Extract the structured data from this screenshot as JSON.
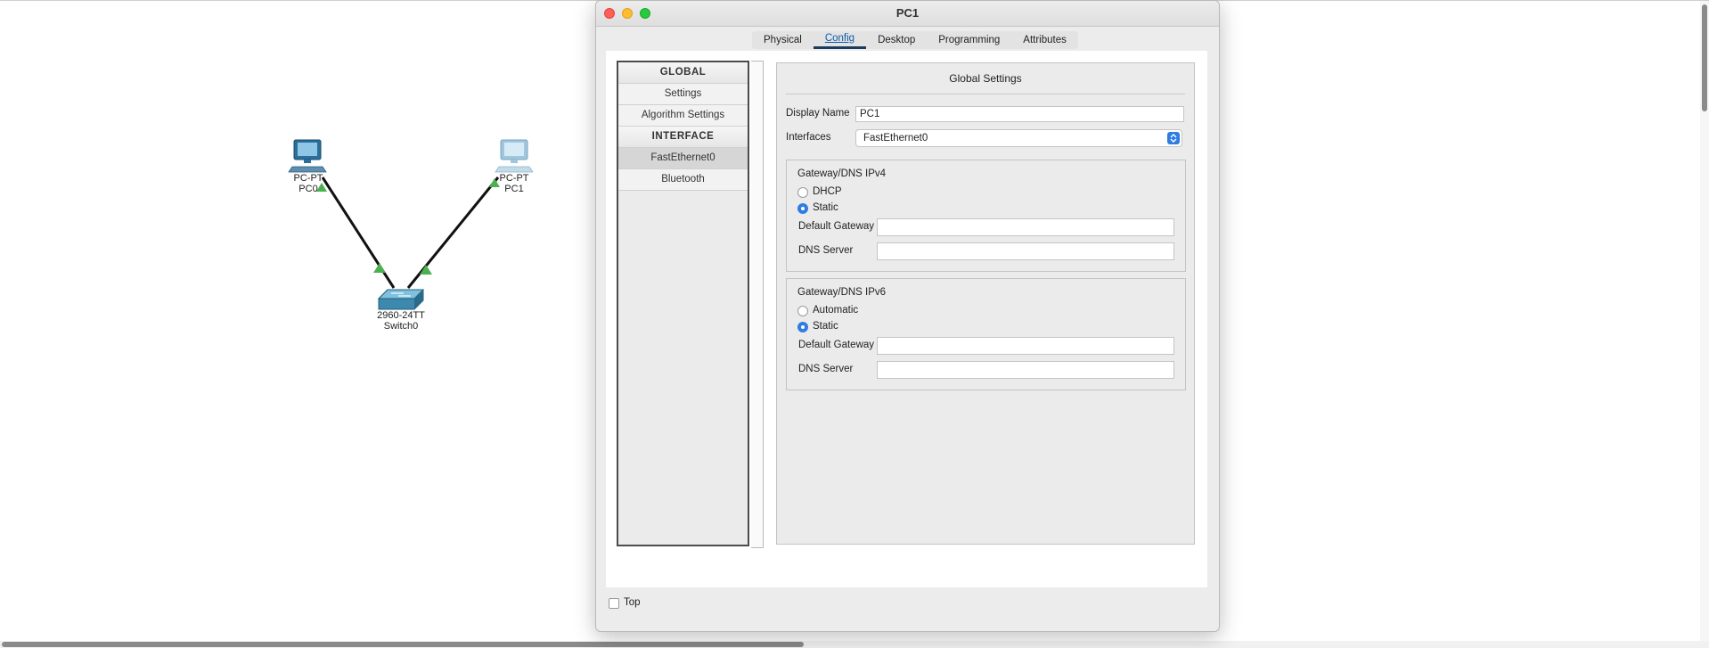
{
  "topology": {
    "devices": [
      {
        "model": "PC-PT",
        "name": "PC0"
      },
      {
        "model": "PC-PT",
        "name": "PC1"
      },
      {
        "model": "2960-24TT",
        "name": "Switch0"
      }
    ],
    "icons": {
      "pc": "desktop-computer-icon",
      "switch": "network-switch-icon",
      "link_status": "link-up-triangle-icon"
    },
    "colors": {
      "link_up": "#4caf50",
      "link_line": "#111111"
    }
  },
  "window": {
    "title": "PC1",
    "tabs": [
      {
        "label": "Physical"
      },
      {
        "label": "Config"
      },
      {
        "label": "Desktop"
      },
      {
        "label": "Programming"
      },
      {
        "label": "Attributes"
      }
    ],
    "active_tab": "Config",
    "sidebar": {
      "items": [
        {
          "label": "GLOBAL",
          "type": "header"
        },
        {
          "label": "Settings"
        },
        {
          "label": "Algorithm Settings"
        },
        {
          "label": "INTERFACE",
          "type": "header"
        },
        {
          "label": "FastEthernet0",
          "selected": true
        },
        {
          "label": "Bluetooth"
        }
      ]
    },
    "global_settings": {
      "title": "Global Settings",
      "display_name_label": "Display Name",
      "display_name_value": "PC1",
      "interfaces_label": "Interfaces",
      "interfaces_value": "FastEthernet0"
    },
    "ipv4": {
      "title": "Gateway/DNS IPv4",
      "option_dhcp": "DHCP",
      "option_static": "Static",
      "selected": "Static",
      "gateway_label": "Default Gateway",
      "gateway_value": "",
      "dns_label": "DNS Server",
      "dns_value": ""
    },
    "ipv6": {
      "title": "Gateway/DNS IPv6",
      "option_automatic": "Automatic",
      "option_static": "Static",
      "selected": "Static",
      "gateway_label": "Default Gateway",
      "gateway_value": "",
      "dns_label": "DNS Server",
      "dns_value": ""
    },
    "top_checkbox_label": "Top",
    "top_checked": false
  }
}
